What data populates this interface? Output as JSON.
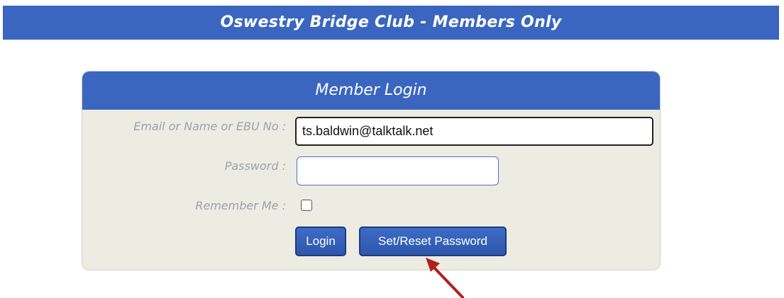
{
  "banner": {
    "title": "Oswestry Bridge Club - Members Only"
  },
  "login": {
    "heading": "Member Login",
    "email_label": "Email or Name or EBU No :",
    "email_value": "ts.baldwin@talktalk.net",
    "password_label": "Password :",
    "password_value": "",
    "remember_label": "Remember Me :",
    "remember_checked": false,
    "login_button": "Login",
    "reset_button": "Set/Reset Password"
  },
  "colors": {
    "brand_blue": "#3a66c0",
    "panel_bg": "#edece3",
    "label_gray": "#9aa2ab",
    "annotation_red": "#b0201e"
  },
  "icons": {
    "annotation": "red-arrow-icon"
  }
}
